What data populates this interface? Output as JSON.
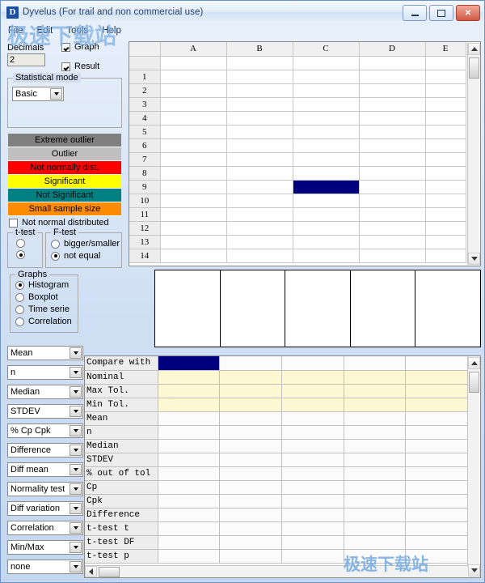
{
  "window": {
    "title": "Dyvelus (For trail and non commercial use)",
    "icon": "D",
    "buttons": {
      "minimize": "minimize-icon",
      "maximize": "maximize-icon",
      "close": "✕"
    }
  },
  "menu": {
    "items": [
      "File",
      "Edit",
      "Tools",
      "Help"
    ]
  },
  "watermark": {
    "text": "极速下载站"
  },
  "left_panel": {
    "decimals_label": "Decimals",
    "decimals_value": "2",
    "checkboxes": [
      {
        "label": "Graph",
        "checked": true
      },
      {
        "label": "Result",
        "checked": true
      }
    ],
    "statistical_mode": {
      "legend": "Statistical mode",
      "value": "Basic"
    },
    "legend_items": [
      {
        "label": "Extreme outlier",
        "color": "#808080",
        "text_color": "#000000"
      },
      {
        "label": "Outlier",
        "color": "#c0c0c0",
        "text_color": "#000000"
      },
      {
        "label": "Not normally dist.",
        "color": "#ff0000",
        "text_color": "#000000"
      },
      {
        "label": "Significant",
        "color": "#ffff00",
        "text_color": "#000000"
      },
      {
        "label": "Not Significant",
        "color": "#008080",
        "text_color": "#000000"
      },
      {
        "label": "Small sample size",
        "color": "#ff8c00",
        "text_color": "#000000"
      }
    ],
    "not_normal_checkbox": {
      "label": "Not normal distributed",
      "checked": false
    },
    "ttest": {
      "legend": "t-test",
      "options": [
        "",
        ""
      ],
      "selected_index": 1
    },
    "ftest": {
      "legend": "F-test",
      "options": [
        "bigger/smaller",
        "not equal"
      ],
      "selected_index": 1
    },
    "graphs": {
      "legend": "Graphs",
      "options": [
        "Histogram",
        "Boxplot",
        "Time serie",
        "Correlation"
      ],
      "selected_index": 0
    },
    "dropdowns": [
      "Mean",
      "n",
      "Median",
      "STDEV",
      "% Cp Cpk",
      "Difference",
      "Diff mean",
      "Normality test",
      "Diff variation",
      "Correlation",
      "Min/Max",
      "none"
    ]
  },
  "sheet": {
    "columns": [
      "A",
      "B",
      "C",
      "D",
      "E"
    ],
    "rows": [
      "",
      "1",
      "2",
      "3",
      "4",
      "5",
      "6",
      "7",
      "8",
      "9",
      "10",
      "11",
      "12",
      "13",
      "14"
    ],
    "selected_cell": {
      "row": "9",
      "column": "C"
    },
    "selection_color": "#00007f"
  },
  "graph_panel": {
    "cells": 5
  },
  "results": {
    "row_labels": [
      "Compare with",
      "Nominal",
      "Max Tol.",
      "Min Tol.",
      "Mean",
      "n",
      "Median",
      "STDEV",
      "% out of tol",
      "Cp",
      "Cpk",
      "Difference",
      "t-test t",
      "t-test DF",
      "t-test p"
    ],
    "highlight_rows": [
      "Nominal",
      "Max Tol.",
      "Min Tol."
    ],
    "highlight_color": "#fdf8d2",
    "selected_row": "Compare with",
    "data_columns": 5,
    "values": [
      [
        "",
        "",
        "",
        "",
        ""
      ],
      [
        "",
        "",
        "",
        "",
        ""
      ],
      [
        "",
        "",
        "",
        "",
        ""
      ],
      [
        "",
        "",
        "",
        "",
        ""
      ],
      [
        "",
        "",
        "",
        "",
        ""
      ],
      [
        "",
        "",
        "",
        "",
        ""
      ],
      [
        "",
        "",
        "",
        "",
        ""
      ],
      [
        "",
        "",
        "",
        "",
        ""
      ],
      [
        "",
        "",
        "",
        "",
        ""
      ],
      [
        "",
        "",
        "",
        "",
        ""
      ],
      [
        "",
        "",
        "",
        "",
        ""
      ],
      [
        "",
        "",
        "",
        "",
        ""
      ],
      [
        "",
        "",
        "",
        "",
        ""
      ],
      [
        "",
        "",
        "",
        "",
        ""
      ],
      [
        "",
        "",
        "",
        "",
        ""
      ]
    ]
  }
}
